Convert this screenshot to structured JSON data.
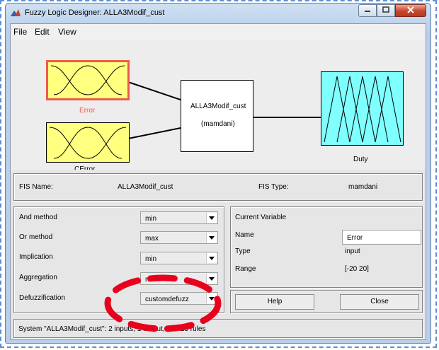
{
  "window": {
    "title": "Fuzzy Logic Designer: ALLA3Modif_cust"
  },
  "menu": {
    "items": [
      "File",
      "Edit",
      "View"
    ]
  },
  "diagram": {
    "input1_label": "Error",
    "input2_label": "CError",
    "system_name": "ALLA3Modif_cust",
    "system_type": "(mamdani)",
    "output_label": "Duty"
  },
  "fis": {
    "name_label": "FIS Name:",
    "name_value": "ALLA3Modif_cust",
    "type_label": "FIS Type:",
    "type_value": "mamdani"
  },
  "methods": {
    "and_label": "And method",
    "and_value": "min",
    "or_label": "Or method",
    "or_value": "max",
    "implication_label": "Implication",
    "implication_value": "min",
    "aggregation_label": "Aggregation",
    "aggregation_value": "max",
    "defuzz_label": "Defuzzification",
    "defuzz_value": "customdefuzz"
  },
  "current_variable": {
    "heading": "Current Variable",
    "name_label": "Name",
    "name_value": "Error",
    "type_label": "Type",
    "type_value": "input",
    "range_label": "Range",
    "range_value": "[-20 20]"
  },
  "buttons": {
    "help": "Help",
    "close": "Close"
  },
  "status": {
    "text": "System \"ALLA3Modif_cust\": 2 inputs, 1 output, and 25 rules"
  },
  "colors": {
    "input_fill": "#ffff80",
    "output_fill": "#80ffff",
    "selected_border": "#f05a4a",
    "annotation": "#e8001c"
  },
  "icons": [
    "matlab-icon",
    "minimize-icon",
    "maximize-icon",
    "close-icon",
    "dropdown-arrow-icon"
  ]
}
